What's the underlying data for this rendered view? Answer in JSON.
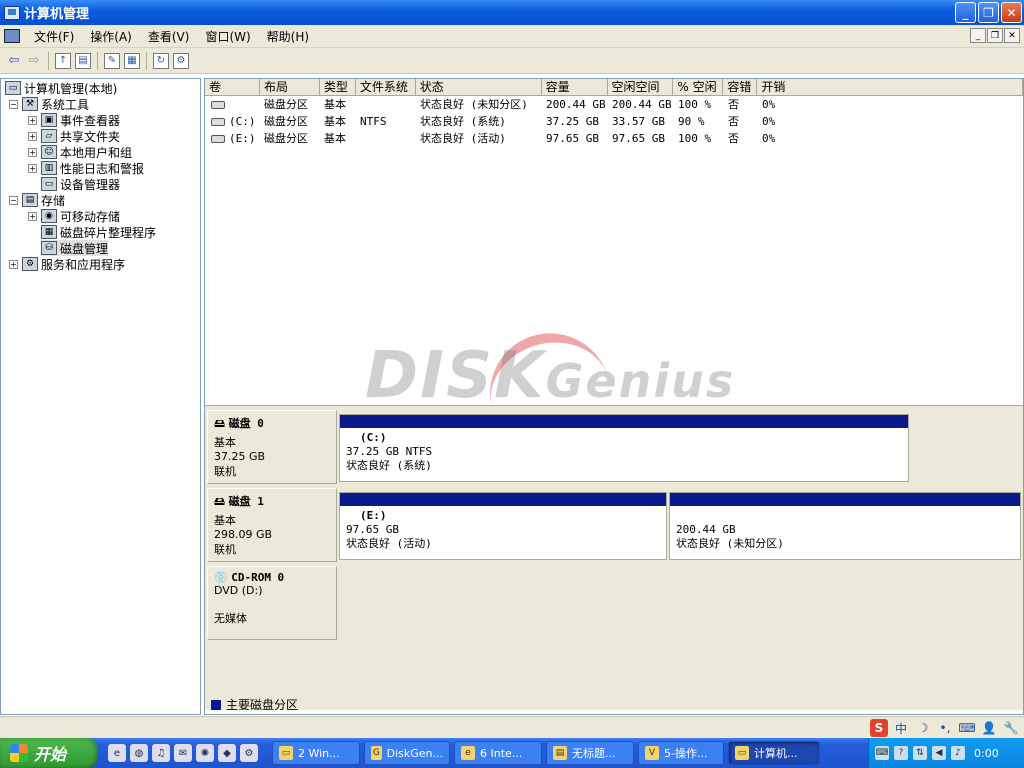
{
  "window": {
    "title": "计算机管理"
  },
  "menu": [
    "文件(F)",
    "操作(A)",
    "查看(V)",
    "窗口(W)",
    "帮助(H)"
  ],
  "tree": [
    {
      "label": "计算机管理(本地)",
      "level": 0,
      "expander": ""
    },
    {
      "label": "系统工具",
      "level": 1,
      "expander": "−"
    },
    {
      "label": "事件查看器",
      "level": 2,
      "expander": "+"
    },
    {
      "label": "共享文件夹",
      "level": 2,
      "expander": "+"
    },
    {
      "label": "本地用户和组",
      "level": 2,
      "expander": "+"
    },
    {
      "label": "性能日志和警报",
      "level": 2,
      "expander": "+"
    },
    {
      "label": "设备管理器",
      "level": 2,
      "expander": ""
    },
    {
      "label": "存储",
      "level": 1,
      "expander": "−"
    },
    {
      "label": "可移动存储",
      "level": 2,
      "expander": "+"
    },
    {
      "label": "磁盘碎片整理程序",
      "level": 2,
      "expander": ""
    },
    {
      "label": "磁盘管理",
      "level": 2,
      "expander": "",
      "selected": true
    },
    {
      "label": "服务和应用程序",
      "level": 1,
      "expander": "+"
    }
  ],
  "volumes": {
    "columns": [
      "卷",
      "布局",
      "类型",
      "文件系统",
      "状态",
      "容量",
      "空闲空间",
      "% 空闲",
      "容错",
      "开销"
    ],
    "rows": [
      [
        "",
        "磁盘分区",
        "基本",
        "",
        "状态良好 (未知分区)",
        "200.44 GB",
        "200.44 GB",
        "100 %",
        "否",
        "0%"
      ],
      [
        "(C:)",
        "磁盘分区",
        "基本",
        "NTFS",
        "状态良好 (系统)",
        "37.25 GB",
        "33.57 GB",
        "90 %",
        "否",
        "0%"
      ],
      [
        "(E:)",
        "磁盘分区",
        "基本",
        "",
        "状态良好 (活动)",
        "97.65 GB",
        "97.65 GB",
        "100 %",
        "否",
        "0%"
      ]
    ]
  },
  "watermark": {
    "text1": "DISK",
    "text2": "Genius"
  },
  "disks": [
    {
      "name": "磁盘 0",
      "type": "基本",
      "size": "37.25 GB",
      "state": "联机",
      "partitions": [
        {
          "label": "(C:)",
          "size": "37.25 GB NTFS",
          "status": "状态良好 (系统)"
        }
      ]
    },
    {
      "name": "磁盘 1",
      "type": "基本",
      "size": "298.09 GB",
      "state": "联机",
      "partitions": [
        {
          "label": "(E:)",
          "size": "97.65 GB",
          "status": "状态良好 (活动)"
        },
        {
          "label": "",
          "size": "200.44 GB",
          "status": "状态良好 (未知分区)"
        }
      ]
    },
    {
      "name": "CD-ROM 0",
      "type": "DVD (D:)",
      "size": "",
      "state": "无媒体",
      "partitions": []
    }
  ],
  "legend": {
    "primary": "主要磁盘分区"
  },
  "ime": [
    "S",
    "中",
    "☽",
    "•,",
    "⌨",
    "👤",
    "🔧"
  ],
  "taskbar": {
    "start": "开始",
    "tasks": [
      "2 Win...",
      "DiskGen...",
      "6 Inte...",
      "无标题...",
      "5-操作...",
      "计算机..."
    ],
    "clock": "0:00"
  }
}
